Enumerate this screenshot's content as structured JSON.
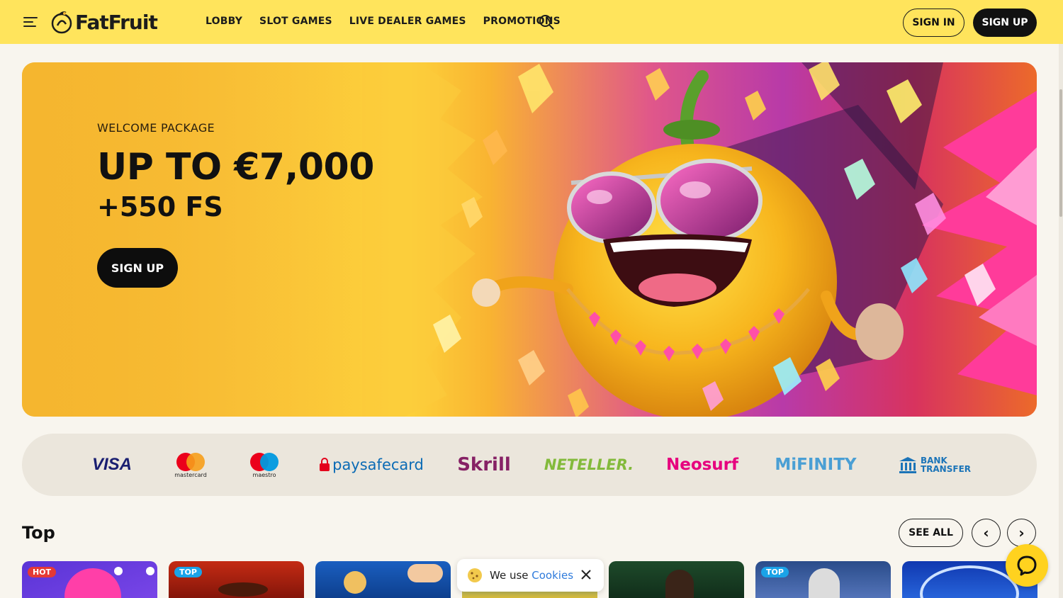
{
  "header": {
    "logo_text": "FatFruit",
    "nav": [
      "LOBBY",
      "SLOT GAMES",
      "LIVE DEALER GAMES",
      "PROMOTIONS"
    ],
    "sign_in": "SIGN IN",
    "sign_up": "SIGN UP"
  },
  "hero": {
    "eyebrow": "WELCOME PACKAGE",
    "title": "UP TO €7,000",
    "subtitle": "+550 FS",
    "cta": "SIGN UP"
  },
  "payments": {
    "visa": "VISA",
    "mastercard": "mastercard",
    "maestro": "maestro",
    "paysafecard": "paysafecard",
    "skrill": "Skrill",
    "neteller": "NETELLER.",
    "neosurf": "Neosurf",
    "mifinity": "MiFINITY",
    "bank_line1": "BANK",
    "bank_line2": "TRANSFER"
  },
  "top_section": {
    "title": "Top",
    "see_all": "SEE ALL",
    "prev": "‹",
    "next": "›",
    "badges": [
      "HOT",
      "TOP",
      "TOP"
    ]
  },
  "cookie": {
    "text": "We use",
    "link": "Cookies"
  },
  "colors": {
    "header_bg": "#ffe45c",
    "page_bg": "#f8f5ee",
    "accent_dark": "#111111",
    "badge_hot": "#e53935",
    "badge_top": "#1aa3e8"
  }
}
